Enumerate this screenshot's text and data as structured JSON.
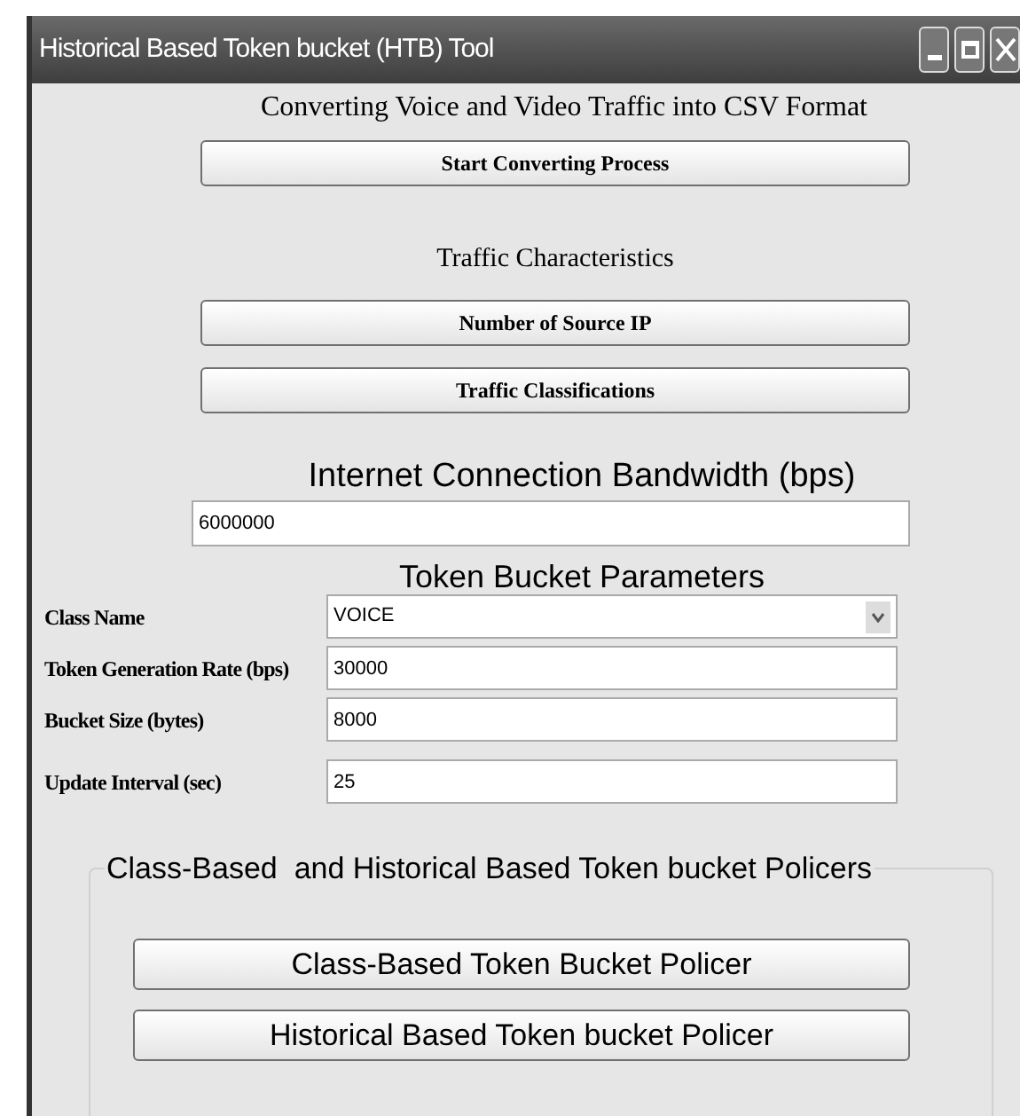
{
  "window": {
    "title": "Historical Based Token bucket (HTB) Tool"
  },
  "conversion": {
    "heading": "Converting Voice and Video Traffic into CSV Format",
    "button": "Start Converting Process"
  },
  "traffic": {
    "heading": "Traffic Characteristics",
    "buttons": [
      "Number of Source IP",
      "Traffic Classifications"
    ]
  },
  "bandwidth": {
    "heading": "Internet Connection Bandwidth (bps)",
    "value": "6000000"
  },
  "parameters": {
    "heading": "Token Bucket Parameters",
    "fields": [
      {
        "kind": "dropdown",
        "label": "Class Name",
        "value": "VOICE"
      },
      {
        "kind": "text",
        "label": "Token Generation Rate (bps)",
        "value": "30000"
      },
      {
        "kind": "text",
        "label": "Bucket Size (bytes)",
        "value": "8000"
      },
      {
        "kind": "text",
        "label": "Update Interval (sec)",
        "value": "25"
      }
    ]
  },
  "policers": {
    "title": "Class-Based  and Historical Based Token bucket Policers",
    "buttons": [
      "Class-Based Token Bucket Policer",
      "Historical Based Token bucket Policer"
    ]
  }
}
